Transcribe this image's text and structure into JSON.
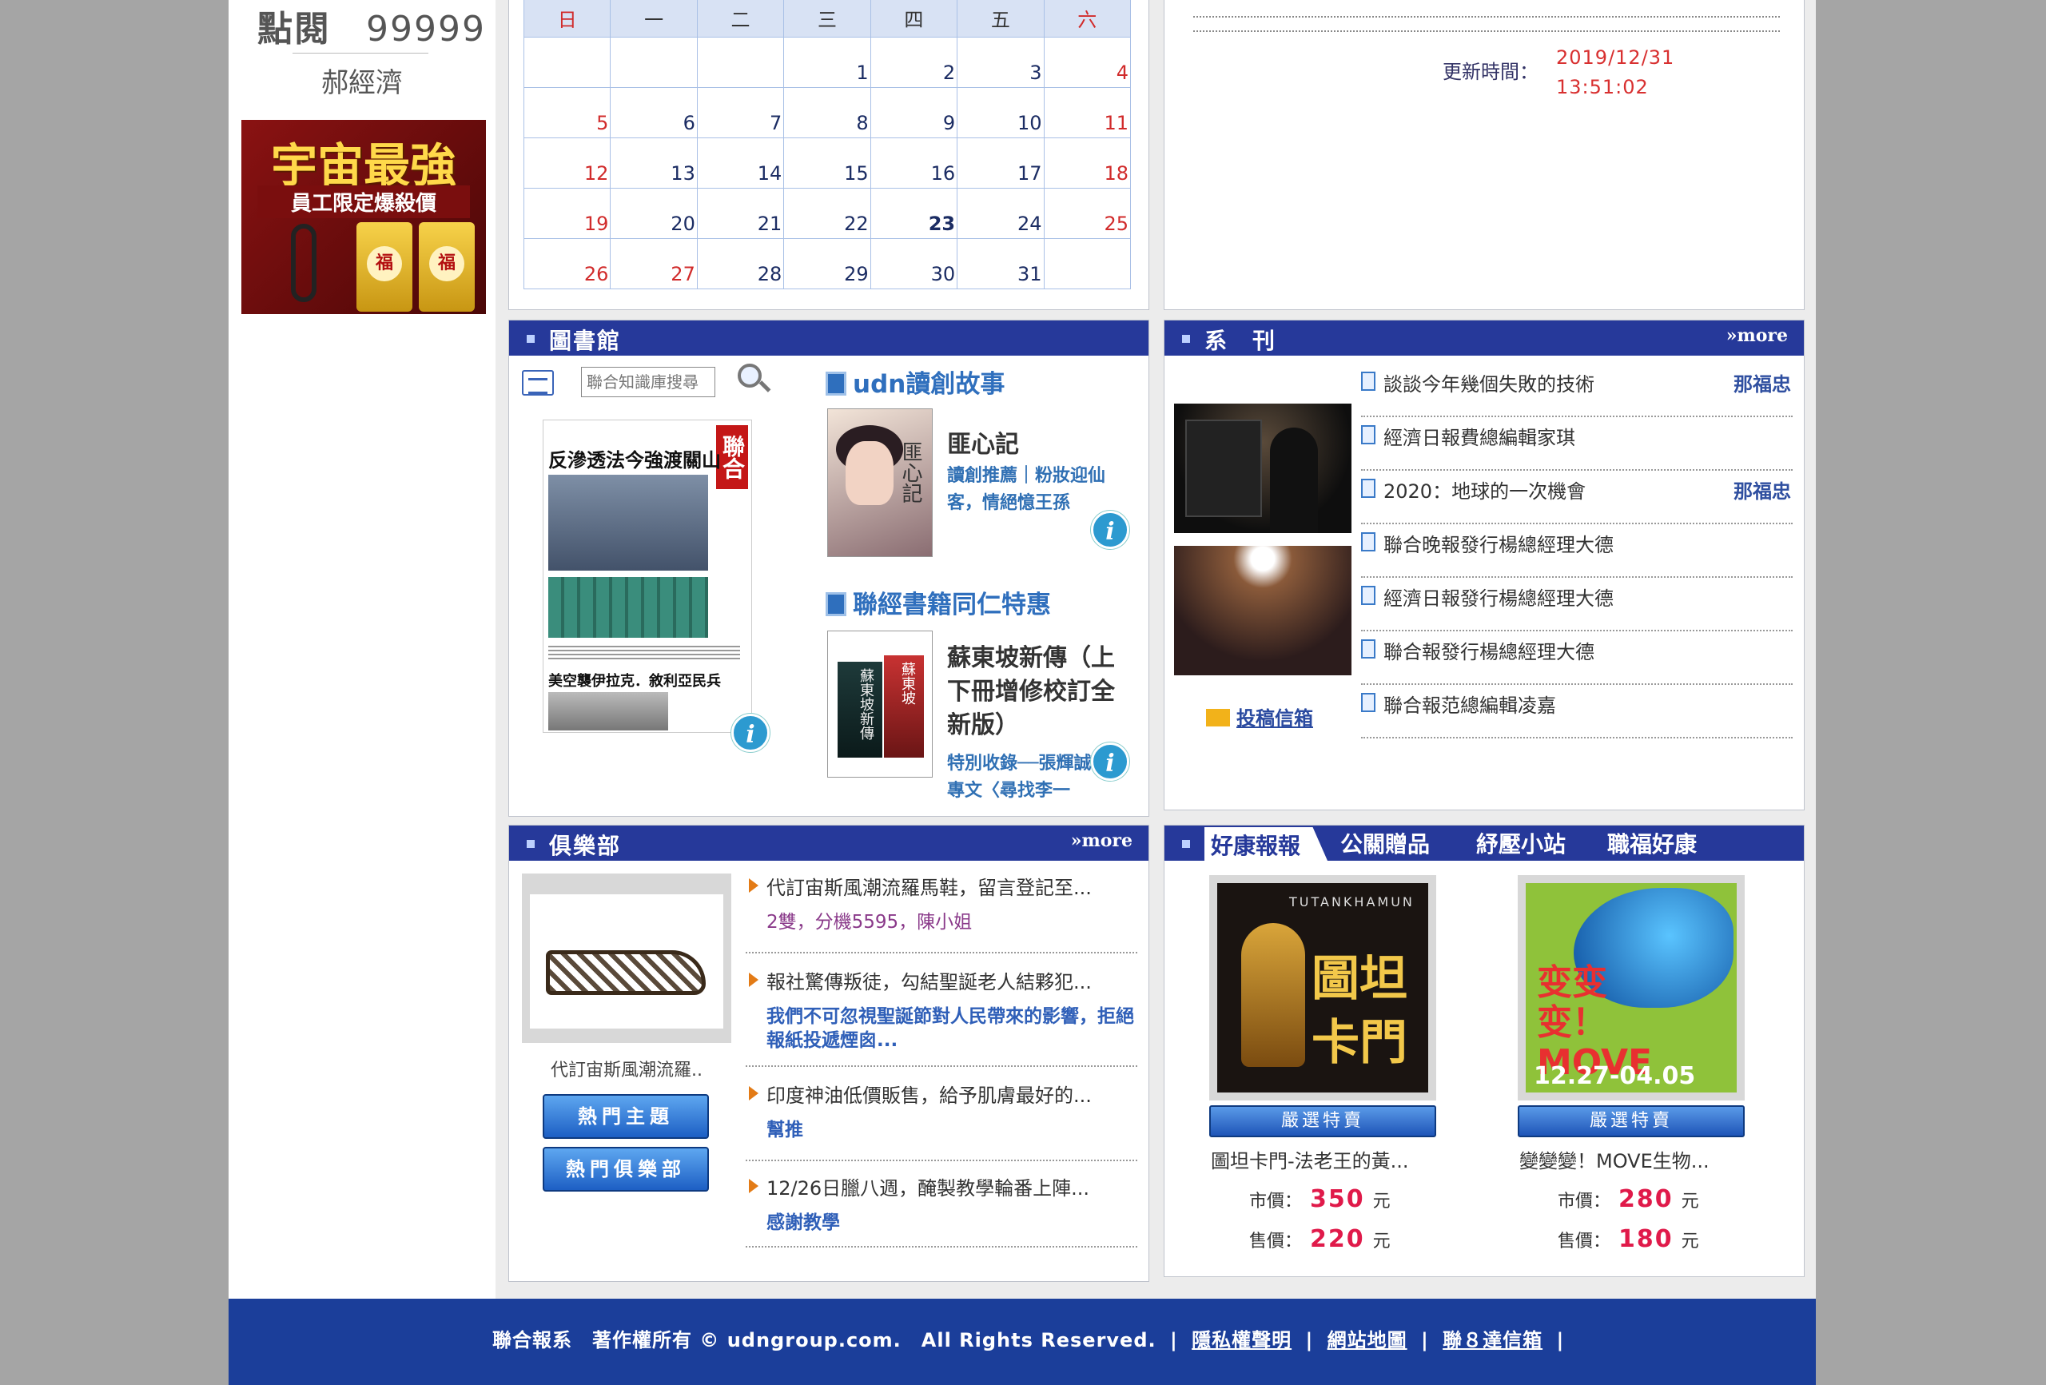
{
  "sidebar": {
    "stat_label": "點閱",
    "stat_value": "99999",
    "author": "郝經濟",
    "promo": {
      "title": "宇宙最強",
      "subtitle": "員工限定爆殺價"
    }
  },
  "calendar": {
    "weekdays": [
      "日",
      "一",
      "二",
      "三",
      "四",
      "五",
      "六"
    ],
    "weeks": [
      [
        "",
        "",
        "",
        "1",
        "2",
        "3",
        "4"
      ],
      [
        "5",
        "6",
        "7",
        "8",
        "9",
        "10",
        "11"
      ],
      [
        "12",
        "13",
        "14",
        "15",
        "16",
        "17",
        "18"
      ],
      [
        "19",
        "20",
        "21",
        "22",
        "23",
        "24",
        "25"
      ],
      [
        "26",
        "27",
        "28",
        "29",
        "30",
        "31",
        ""
      ]
    ],
    "today": "23"
  },
  "stock": {
    "update_label": "更新時間：",
    "update_date": "2019/12/31",
    "update_time": "13:51:02"
  },
  "library": {
    "title": "圖書館",
    "search_placeholder": "聯合知識庫搜尋",
    "newspaper": {
      "headline": "反滲透法今強渡關山",
      "masthead": "聯合報",
      "headline2": "美空襲伊拉克．敘利亞民兵"
    },
    "section1": {
      "title": "udn讀創故事",
      "book_title": "匪心記",
      "book_cover_text": "匪心記",
      "book_desc": "讀創推薦｜粉妝迎仙客，情絕憶王孫"
    },
    "section2": {
      "title": "聯經書籍同仁特惠",
      "book_title": "蘇東坡新傳（上下冊增修校訂全新版）",
      "book_cover_a": "蘇東坡新傳",
      "book_cover_b": "蘇東坡",
      "book_desc": "特別收錄──張輝誠專文〈尋找李一"
    }
  },
  "series": {
    "title": "系　刊",
    "more": "»more",
    "items": [
      {
        "title": "談談今年幾個失敗的技術",
        "author": "那福忠"
      },
      {
        "title": "經濟日報費總編輯家琪",
        "author": ""
      },
      {
        "title": "2020：地球的一次機會",
        "author": "那福忠"
      },
      {
        "title": "聯合晚報發行楊總經理大德",
        "author": ""
      },
      {
        "title": "經濟日報發行楊總經理大德",
        "author": ""
      },
      {
        "title": "聯合報發行楊總經理大德",
        "author": ""
      },
      {
        "title": "聯合報范總編輯凌嘉",
        "author": ""
      }
    ],
    "mailbox": "投稿信箱"
  },
  "club": {
    "title": "俱樂部",
    "more": "»more",
    "image_caption": "代訂宙斯風潮流羅..",
    "buttons": [
      "熱門主題",
      "熱門俱樂部"
    ],
    "items": [
      {
        "title": "代訂宙斯風潮流羅馬鞋，留言登記至...",
        "desc": "2雙，分機5595，陳小姐"
      },
      {
        "title": "報社驚傳叛徒，勾結聖誕老人結夥犯...",
        "desc": "我們不可忽視聖誕節對人民帶來的影響，拒絕報紙投遞煙囪..."
      },
      {
        "title": "印度神油低價販售，給予肌膚最好的...",
        "desc": "幫推"
      },
      {
        "title": "12/26日臘八週，醃製教學輪番上陣...",
        "desc": "感謝教學"
      }
    ]
  },
  "shop": {
    "tabs": [
      "好康報報",
      "公關贈品",
      "紓壓小站",
      "職福好康"
    ],
    "select_label": "嚴選特賣",
    "market_label": "市價：",
    "sale_label": "售價：",
    "currency": "元",
    "products": [
      {
        "name": "圖坦卡門-法老王的黃...",
        "market_price": "350",
        "sale_price": "220",
        "img_big": "圖坦卡門",
        "img_small": "TUTANKHAMUN"
      },
      {
        "name": "變變變！MOVE生物...",
        "market_price": "280",
        "sale_price": "180",
        "img_big": "变变变！MOVE",
        "img_small": "12.27-04.05"
      }
    ]
  },
  "footer": {
    "copyright": "聯合報系　著作權所有 © udngroup.com.　All Rights Reserved.",
    "links": [
      "隱私權聲明",
      "網站地圖",
      "聯８達信箱"
    ]
  }
}
